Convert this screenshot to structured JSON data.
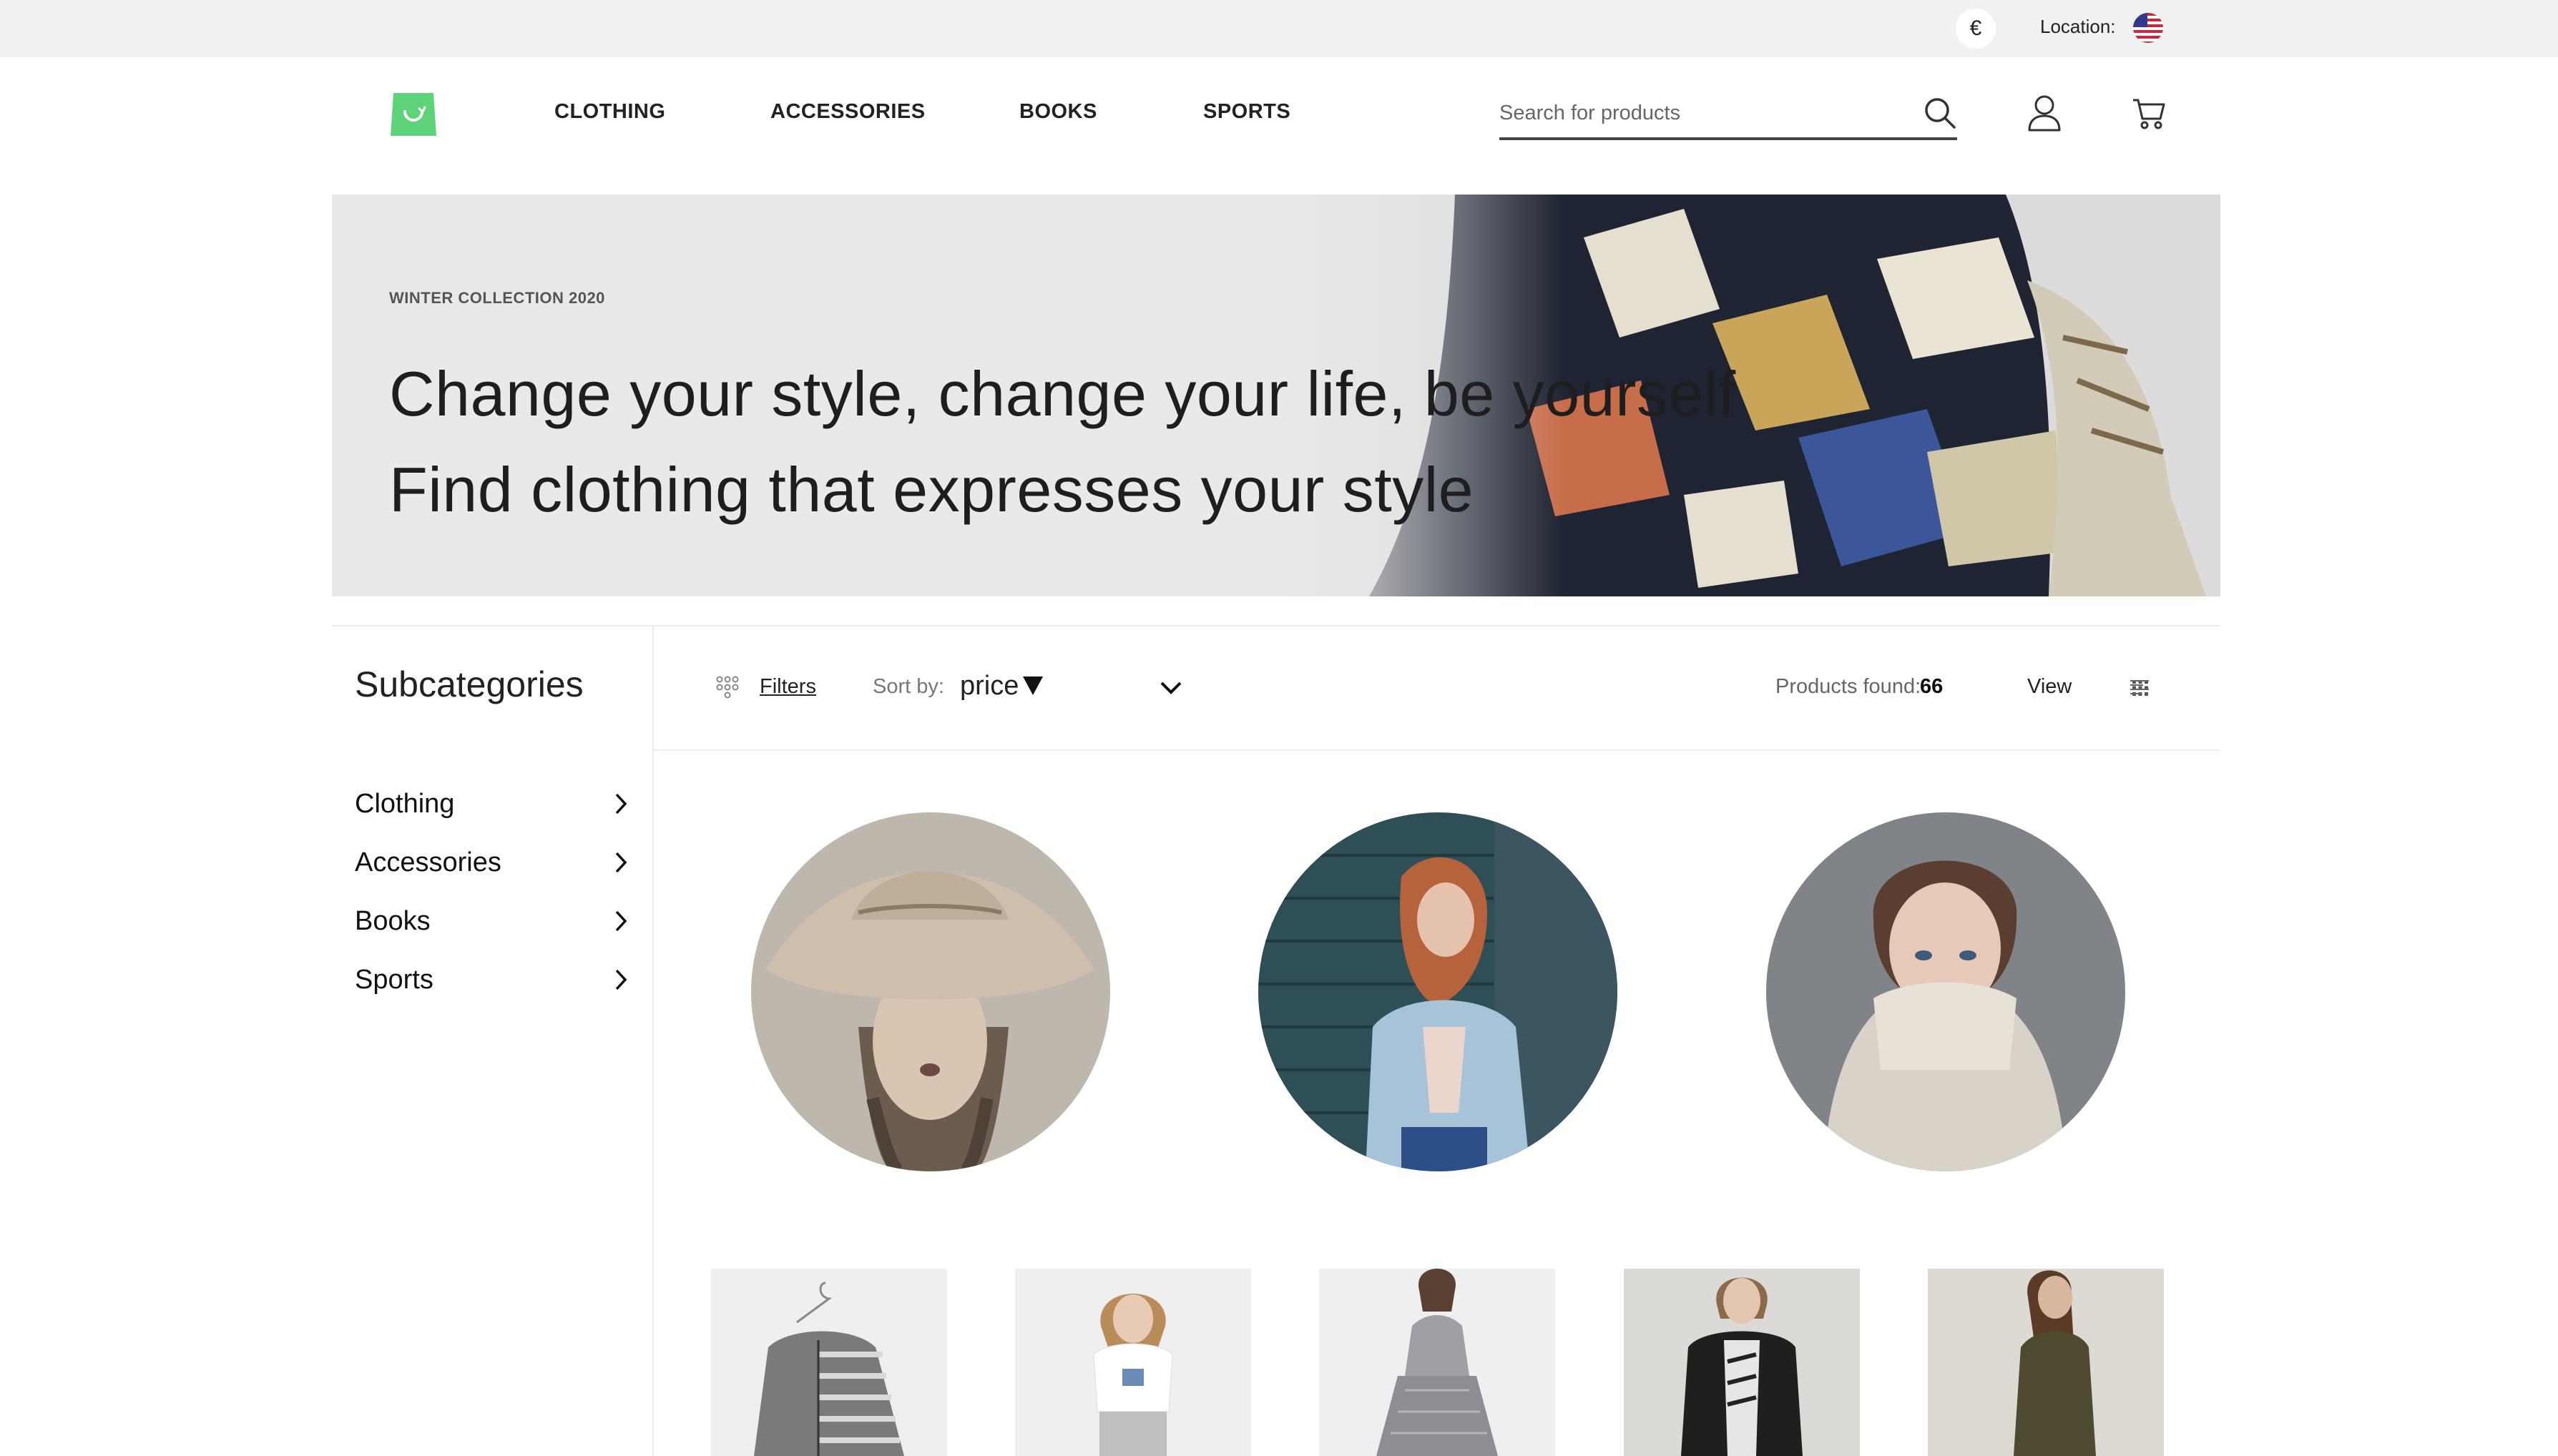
{
  "topbar": {
    "currency_symbol": "€",
    "location_label": "Location:",
    "flag_icon": "us-flag-icon"
  },
  "header": {
    "logo_icon": "shopping-bag-logo",
    "nav": [
      "CLOTHING",
      "ACCESSORIES",
      "BOOKS",
      "SPORTS"
    ],
    "search": {
      "placeholder": "Search for products",
      "value": ""
    },
    "icons": [
      "search-icon",
      "user-icon",
      "cart-icon"
    ],
    "accent_color": "#5fd37a"
  },
  "hero": {
    "eyebrow": "WINTER COLLECTION 2020",
    "line1": "Change your style, change your life, be yourself",
    "line2": "Find clothing that expresses your style"
  },
  "sidebar": {
    "title": "Subcategories",
    "items": [
      "Clothing",
      "Accessories",
      "Books",
      "Sports"
    ]
  },
  "toolbar": {
    "filters_label": "Filters",
    "sort_label": "Sort by:",
    "sort_value": "price",
    "found_label": "Products found:",
    "found_count": "66",
    "view_label": "View"
  }
}
